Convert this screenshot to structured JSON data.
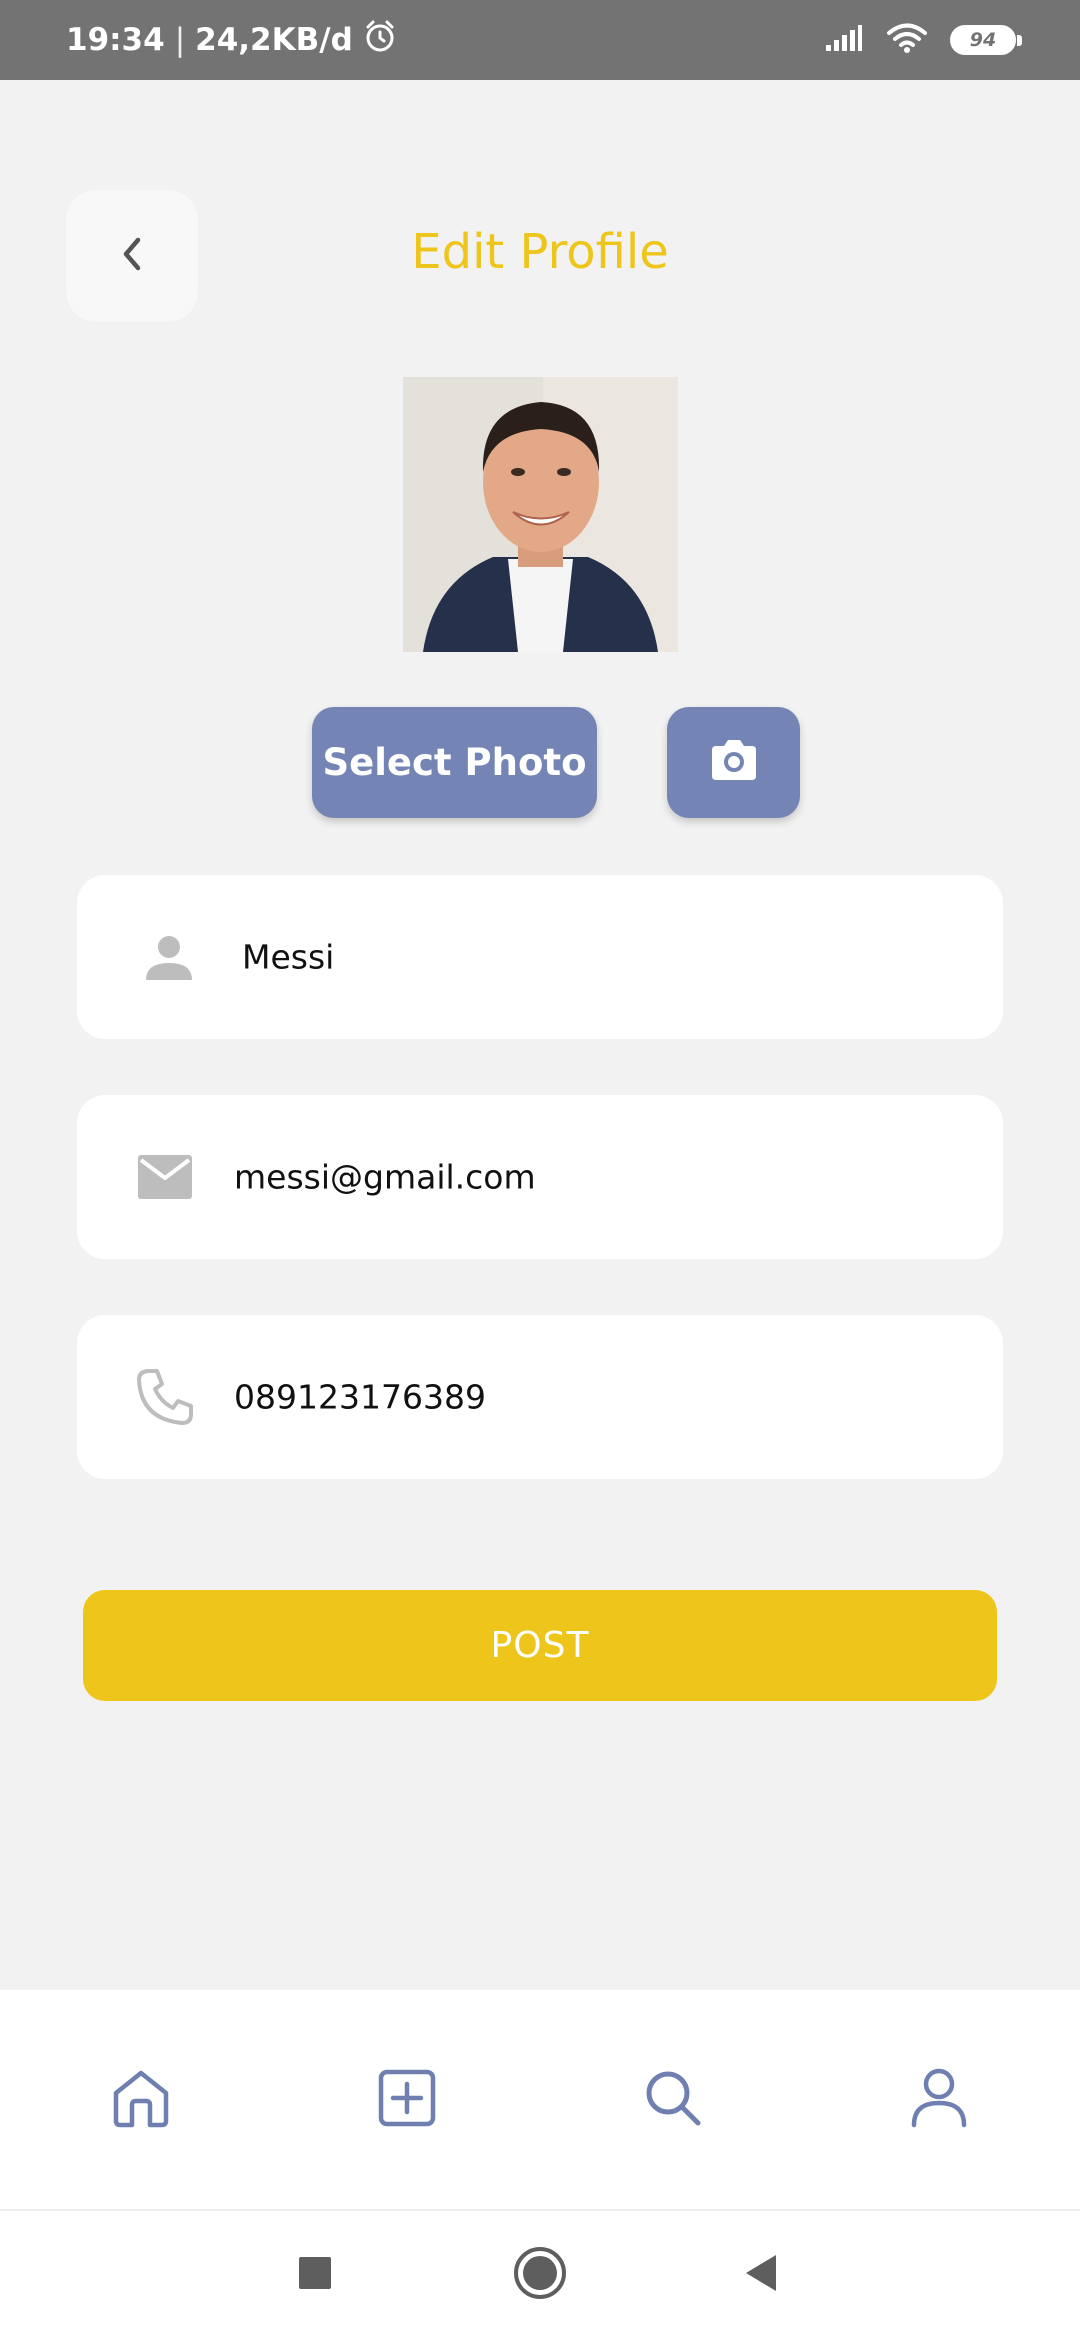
{
  "status_bar": {
    "time": "19:34",
    "separator": "|",
    "network_speed": "24,2KB/d",
    "battery_level": "94",
    "icons": [
      "alarm-icon",
      "signal-icon",
      "wifi-icon",
      "battery-icon"
    ]
  },
  "header": {
    "title": "Edit Profile",
    "back_icon": "chevron-left-icon"
  },
  "photo_actions": {
    "select_label": "Select Photo",
    "camera_icon": "camera-icon"
  },
  "fields": {
    "name": {
      "icon": "person-icon",
      "value": "Messi"
    },
    "email": {
      "icon": "mail-icon",
      "value": "messi@gmail.com"
    },
    "phone": {
      "icon": "phone-icon",
      "value": "089123176389"
    }
  },
  "post_button": {
    "label": "POST"
  },
  "bottom_nav": {
    "items": [
      "home-icon",
      "add-square-icon",
      "search-icon",
      "profile-icon"
    ]
  },
  "system_nav": {
    "items": [
      "recents-icon",
      "home-circle-icon",
      "back-triangle-icon"
    ]
  },
  "colors": {
    "accent_yellow": "#eec51a",
    "button_blue": "#7484b4",
    "nav_icon": "#6f7fb0",
    "field_icon": "#bdbdbd",
    "background": "#f2f2f2"
  }
}
